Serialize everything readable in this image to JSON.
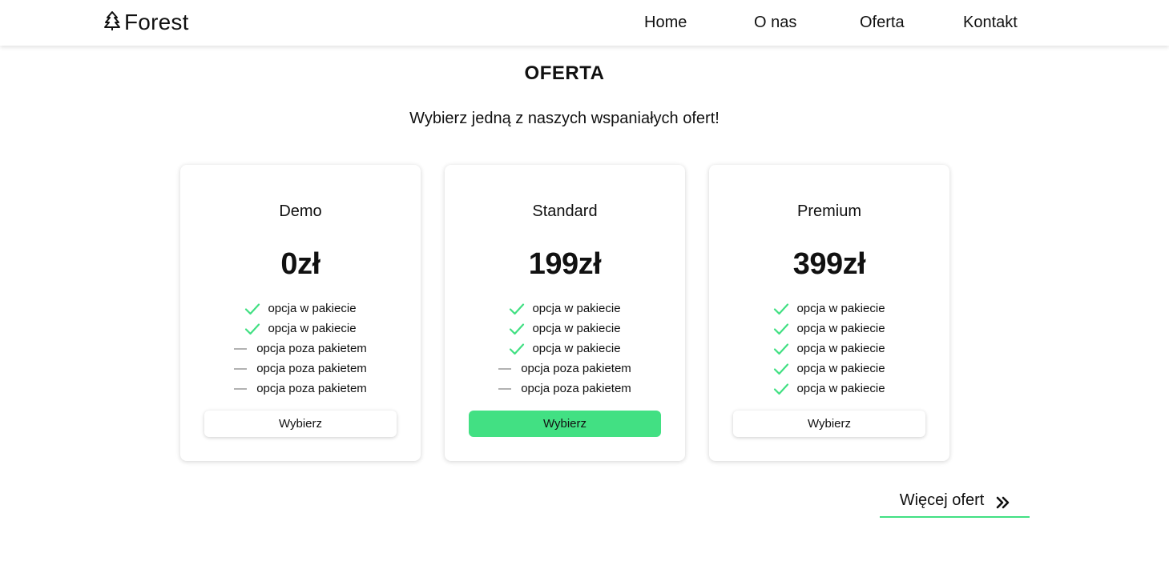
{
  "header": {
    "logo_text": "Forest",
    "nav": [
      "Home",
      "O nas",
      "Oferta",
      "Kontakt"
    ]
  },
  "page": {
    "title": "OFERTA",
    "subtitle": "Wybierz jedną z naszych wspaniałych ofert!"
  },
  "plans": [
    {
      "name": "Demo",
      "price": "0zł",
      "features": [
        {
          "text": "opcja w pakiecie",
          "included": true
        },
        {
          "text": "opcja w pakiecie",
          "included": true
        },
        {
          "text": "opcja poza pakietem",
          "included": false
        },
        {
          "text": "opcja poza pakietem",
          "included": false
        },
        {
          "text": "opcja poza pakietem",
          "included": false
        }
      ],
      "button": "Wybierz",
      "highlighted": false
    },
    {
      "name": "Standard",
      "price": "199zł",
      "features": [
        {
          "text": "opcja w pakiecie",
          "included": true
        },
        {
          "text": "opcja w pakiecie",
          "included": true
        },
        {
          "text": "opcja w pakiecie",
          "included": true
        },
        {
          "text": "opcja poza pakietem",
          "included": false
        },
        {
          "text": "opcja poza pakietem",
          "included": false
        }
      ],
      "button": "Wybierz",
      "highlighted": true
    },
    {
      "name": "Premium",
      "price": "399zł",
      "features": [
        {
          "text": "opcja w pakiecie",
          "included": true
        },
        {
          "text": "opcja w pakiecie",
          "included": true
        },
        {
          "text": "opcja w pakiecie",
          "included": true
        },
        {
          "text": "opcja w pakiecie",
          "included": true
        },
        {
          "text": "opcja w pakiecie",
          "included": true
        }
      ],
      "button": "Wybierz",
      "highlighted": false
    }
  ],
  "more_link": {
    "label": "Więcej ofert",
    "icon": "double-chevron-right-icon"
  },
  "icons": {
    "logo": "tree-icon",
    "included": "check-icon",
    "excluded": "dash-icon"
  },
  "colors": {
    "accent": "#42e083",
    "text": "#111111",
    "muted": "#9e9e9e"
  }
}
